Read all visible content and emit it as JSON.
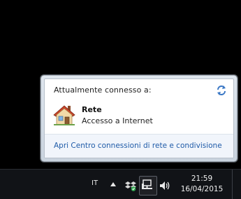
{
  "flyout": {
    "title": "Attualmente connesso a:",
    "network": {
      "name": "Rete",
      "status": "Accesso a Internet",
      "icon": "home-network-icon"
    },
    "refresh_icon": "refresh-icon",
    "open_center_link": "Apri Centro connessioni di rete e condivisione"
  },
  "taskbar": {
    "language": "IT",
    "tray_icons": [
      "show-hidden-icons-arrow",
      "dropbox-icon",
      "network-icon",
      "volume-icon"
    ],
    "clock": {
      "time": "21:59",
      "date": "16/04/2015"
    }
  },
  "colors": {
    "link": "#1f5ba8",
    "taskbar": "#111317",
    "background": "#000000"
  }
}
